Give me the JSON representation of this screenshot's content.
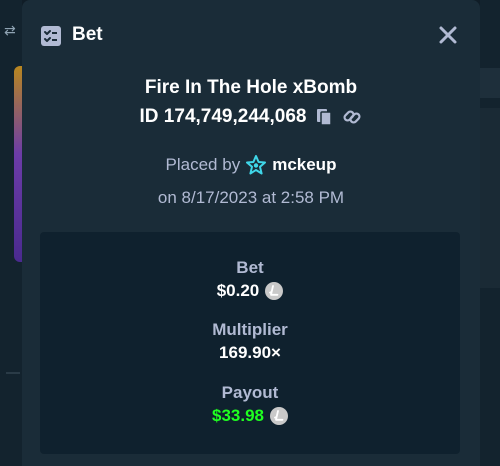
{
  "modal": {
    "title": "Bet",
    "game_title": "Fire In The Hole xBomb",
    "bet_id": "ID 174,749,244,068",
    "placed_by_label": "Placed by",
    "placed_by_user": "mckeup",
    "date": "on 8/17/2023 at 2:58 PM"
  },
  "details": {
    "bet_label": "Bet",
    "bet_value": "$0.20",
    "multiplier_label": "Multiplier",
    "multiplier_value": "169.90×",
    "payout_label": "Payout",
    "payout_value": "$33.98"
  },
  "icons": {
    "header": "bet-slip-icon",
    "close": "close-icon",
    "copy": "copy-icon",
    "link": "link-icon",
    "user_badge": "star-badge-icon",
    "currency": "litecoin-icon"
  },
  "colors": {
    "modal_bg": "#1a2c38",
    "card_bg": "#0f212e",
    "muted_text": "#b1bad3",
    "payout_green": "#1fff20",
    "badge_cyan": "#3fd6e8"
  }
}
